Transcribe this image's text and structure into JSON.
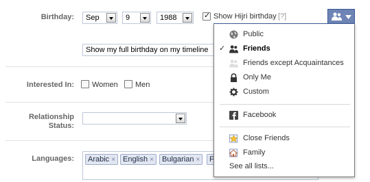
{
  "birthday": {
    "label": "Birthday:",
    "month": "Sep",
    "day": "9",
    "year": "1988",
    "hijri_label": "Show Hijri birthday",
    "hijri_help": "[?]",
    "hijri_checked": true,
    "display_option": "Show my full birthday on my timeline"
  },
  "interested_in": {
    "label": "Interested In:",
    "options": [
      {
        "label": "Women",
        "checked": false
      },
      {
        "label": "Men",
        "checked": false
      }
    ]
  },
  "relationship": {
    "label_line1": "Relationship",
    "label_line2": "Status:",
    "value": ""
  },
  "languages": {
    "label": "Languages:",
    "tokens": [
      "Arabic",
      "English",
      "Bulgarian",
      "Fr"
    ],
    "remove_glyph": "×"
  },
  "audience_selector": {
    "current": "Friends",
    "icon": "friends-icon",
    "button_color": "#6d84b4"
  },
  "audience_menu": {
    "items": [
      {
        "label": "Public",
        "icon": "globe-icon",
        "selected": false
      },
      {
        "label": "Friends",
        "icon": "friends-icon",
        "selected": true
      },
      {
        "label": "Friends except Acquaintances",
        "icon": "friends-except-acquaintances-icon",
        "selected": false
      },
      {
        "label": "Only Me",
        "icon": "lock-icon",
        "selected": false
      },
      {
        "label": "Custom",
        "icon": "gear-icon",
        "selected": false
      }
    ],
    "network": {
      "label": "Facebook",
      "icon": "facebook-icon"
    },
    "lists": [
      {
        "label": "Close Friends",
        "icon": "star-icon"
      },
      {
        "label": "Family",
        "icon": "house-icon"
      }
    ],
    "see_all": "See all lists...",
    "check_glyph": "✓"
  }
}
